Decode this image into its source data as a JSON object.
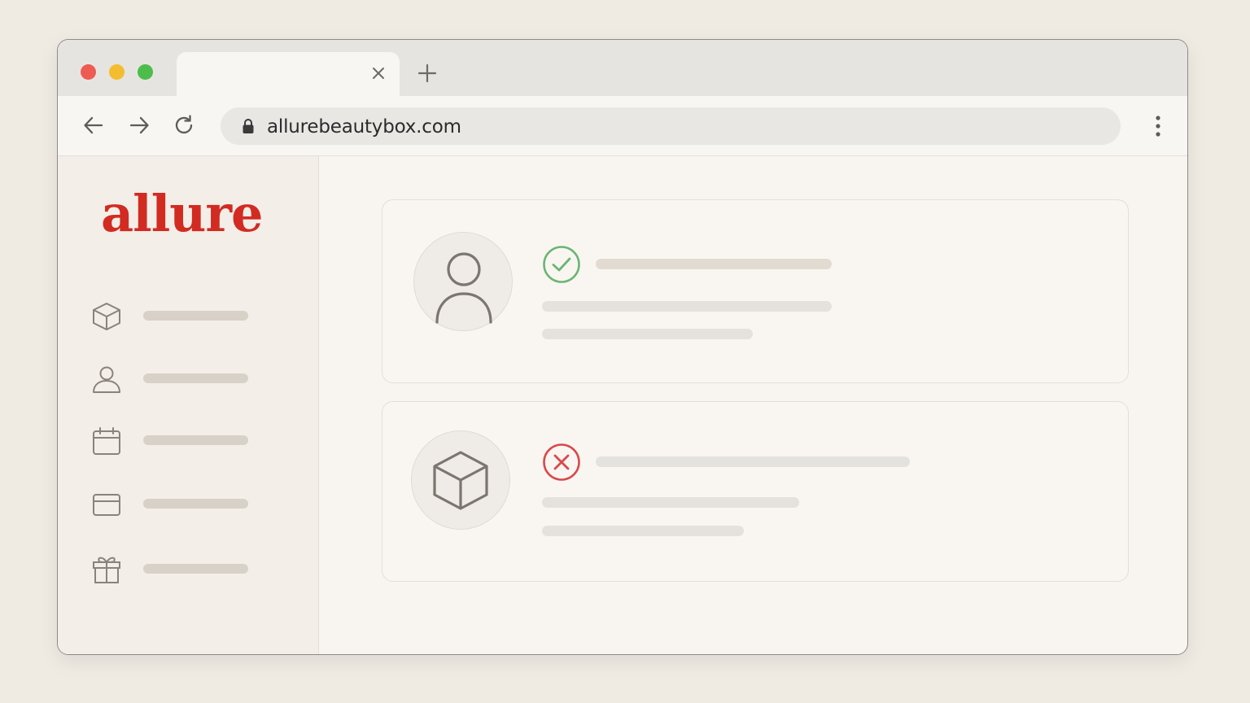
{
  "browser": {
    "tab_title": "",
    "url": "allurebeautybox.com"
  },
  "sidebar": {
    "logo": "allure",
    "items": [
      {
        "icon": "box-icon",
        "label": ""
      },
      {
        "icon": "user-icon",
        "label": ""
      },
      {
        "icon": "calendar-icon",
        "label": ""
      },
      {
        "icon": "credit-card-icon",
        "label": ""
      },
      {
        "icon": "gift-icon",
        "label": ""
      }
    ]
  },
  "cards": [
    {
      "icon": "user-icon",
      "status": "success",
      "status_icon": "check-circle-icon",
      "status_color": "#6bb673"
    },
    {
      "icon": "box-icon",
      "status": "error",
      "status_icon": "x-circle-icon",
      "status_color": "#d94a4a"
    }
  ],
  "colors": {
    "brand": "#d22b22",
    "background": "#efebe3",
    "skeleton": "#e2ddd6"
  }
}
